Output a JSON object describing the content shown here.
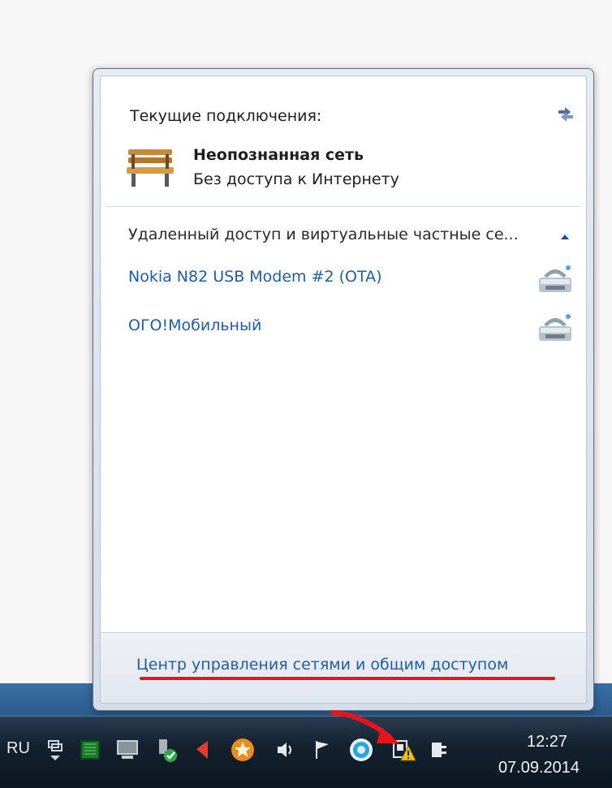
{
  "flyout": {
    "header": "Текущие подключения:",
    "current_connection": {
      "name": "Неопознанная сеть",
      "status": "Без доступа к Интернету",
      "icon": "bench-icon"
    },
    "dialup_section": {
      "title": "Удаленный доступ и виртуальные частные се...",
      "items": [
        {
          "label": "Nokia N82 USB Modem #2 (OTA)",
          "icon": "modem-icon"
        },
        {
          "label": "ОГО!Мобильный",
          "icon": "modem-icon"
        }
      ]
    },
    "footer_link": "Центр управления сетями и общим доступом"
  },
  "taskbar": {
    "language": "RU",
    "tray_icons": [
      "language-switch-icon",
      "green-chip-icon",
      "network-computer-icon",
      "usb-safe-remove-icon",
      "red-flag-app-icon",
      "star-app-icon",
      "volume-icon",
      "action-center-flag-icon",
      "blue-circle-app-icon",
      "network-warning-icon",
      "power-icon"
    ],
    "clock": {
      "time": "12:27",
      "date": "07.09.2014"
    }
  },
  "colors": {
    "link": "#1f5da8",
    "annotation_red": "#e8141c"
  }
}
